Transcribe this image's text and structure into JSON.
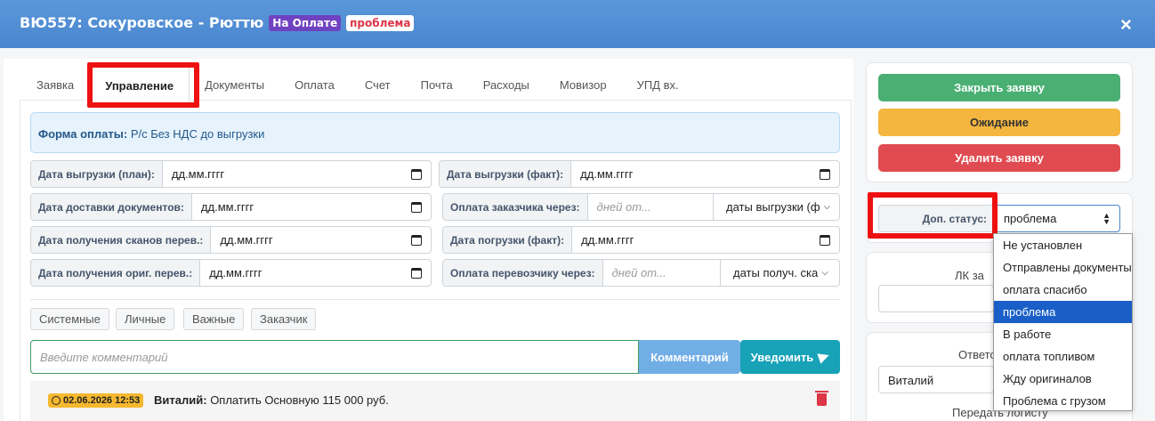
{
  "header": {
    "title": "ВЮ557: Сокуровское - Рюттю",
    "badge_paid": "На Оплате",
    "badge_problem": "проблема",
    "close": "×"
  },
  "tabs": [
    {
      "label": "Заявка",
      "active": false
    },
    {
      "label": "Управление",
      "active": true
    },
    {
      "label": "Документы",
      "active": false
    },
    {
      "label": "Оплата",
      "active": false
    },
    {
      "label": "Счет",
      "active": false
    },
    {
      "label": "Почта",
      "active": false
    },
    {
      "label": "Расходы",
      "active": false
    },
    {
      "label": "Мовизор",
      "active": false
    },
    {
      "label": "УПД вх.",
      "active": false
    }
  ],
  "payment_form": {
    "label": "Форма оплаты:",
    "value": "Р/с Без НДС до выгрузки"
  },
  "fields": {
    "unload_plan": {
      "label": "Дата выгрузки (план):",
      "value": "дд.мм.гггг"
    },
    "unload_fact": {
      "label": "Дата выгрузки (факт):",
      "value": "дд.мм.гггг"
    },
    "docs_delivery": {
      "label": "Дата доставки документов:",
      "value": "дд.мм.гггг"
    },
    "customer_payment": {
      "label": "Оплата заказчика через:",
      "placeholder": "дней от...",
      "select": "даты выгрузки (ф"
    },
    "scans_received": {
      "label": "Дата получения сканов перев.:",
      "value": "дд.мм.гггг"
    },
    "load_fact": {
      "label": "Дата погрузки (факт):",
      "value": "дд.мм.гггг"
    },
    "originals_received": {
      "label": "Дата получения ориг. перев.:",
      "value": "дд.мм.гггг"
    },
    "carrier_payment": {
      "label": "Оплата перевозчику через:",
      "placeholder": "дней от...",
      "select": "даты получ. ска"
    }
  },
  "filters": [
    "Системные",
    "Личные",
    "Важные",
    "Заказчик"
  ],
  "comment": {
    "placeholder": "Введите комментарий",
    "comment_button": "Комментарий",
    "notify_button": "Уведомить"
  },
  "comment_entry": {
    "date": "02.06.2026 12:53",
    "author": "Виталий:",
    "text": "Оплатить Основную 115 000 руб."
  },
  "actions": {
    "close_request": "Закрыть заявку",
    "waiting": "Ожидание",
    "delete_request": "Удалить заявку"
  },
  "extra_status": {
    "label": "Доп. статус:",
    "value": "проблема",
    "options": [
      {
        "label": "Не установлен",
        "selected": false
      },
      {
        "label": "Отправлены документы",
        "selected": false
      },
      {
        "label": "оплата спасибо",
        "selected": false
      },
      {
        "label": "проблема",
        "selected": true
      },
      {
        "label": "В работе",
        "selected": false
      },
      {
        "label": "оплата топливом",
        "selected": false
      },
      {
        "label": "Жду оригиналов",
        "selected": false
      },
      {
        "label": "Проблема с грузом",
        "selected": false
      }
    ]
  },
  "side": {
    "lk_label": "ЛК за",
    "responsible_label": "Ответс",
    "responsible_value": "Виталий",
    "transfer_label": "Передать логисту"
  },
  "colors": {
    "header": "#4a86cf",
    "badge_paid": "#6f42c1",
    "badge_problem_text": "#dc3545",
    "success": "#4aaf73",
    "warning": "#f4b63f",
    "danger": "#e04b51",
    "info": "#17a2b8",
    "highlight_frame": "#ee1111",
    "selected_option": "#1a5fc8"
  }
}
